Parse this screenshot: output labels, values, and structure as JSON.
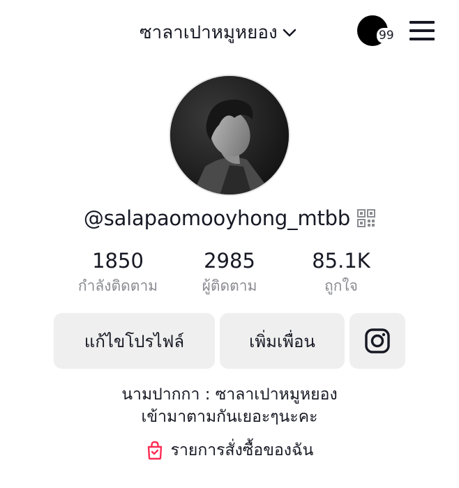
{
  "header": {
    "title": "ซาลาเปาหมูหยอง",
    "notification_count": "99",
    "icons": {
      "dropdown": "chevron-down-icon",
      "menu": "hamburger-menu-icon"
    }
  },
  "profile": {
    "username": "@salapaomooyhong_mtbb",
    "qr_icon": "qr-code-icon"
  },
  "stats": [
    {
      "value": "1850",
      "label": "กำลังติดตาม"
    },
    {
      "value": "2985",
      "label": "ผู้ติดตาม"
    },
    {
      "value": "85.1K",
      "label": "ถูกใจ"
    }
  ],
  "actions": {
    "edit_profile": "แก้ไขโปรไฟล์",
    "add_friend": "เพิ่มเพื่อน",
    "instagram_icon": "instagram-icon"
  },
  "bio": {
    "line1": "นามปากกา : ซาลาเปาหมูหยอง",
    "line2": "เข้ามาตามกันเยอะๆนะคะ"
  },
  "shop": {
    "label": "รายการสั่งซื้อของฉัน",
    "icon": "shopping-bag-icon"
  },
  "colors": {
    "text": "#161823",
    "secondary_text": "#8a8b91",
    "button_bg": "#efefef",
    "accent": "#fe2c55"
  }
}
